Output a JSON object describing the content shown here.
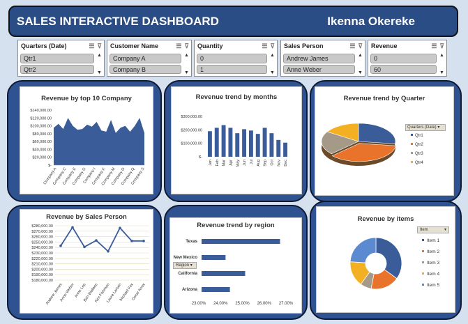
{
  "header": {
    "title": "SALES INTERACTIVE DASHBOARD",
    "author": "Ikenna Okereke"
  },
  "slicers": [
    {
      "title": "Quarters (Date)",
      "items": [
        "Qtr1",
        "Qtr2"
      ]
    },
    {
      "title": "Customer Name",
      "items": [
        "Company A",
        "Company B"
      ]
    },
    {
      "title": "Quantity",
      "items": [
        "0",
        "1"
      ]
    },
    {
      "title": "Sales Person",
      "items": [
        "Andrew James",
        "Anne Weber"
      ]
    },
    {
      "title": "Revenue",
      "items": [
        "0",
        "60"
      ]
    }
  ],
  "charts": {
    "company": {
      "title": "Revenue by top 10 Company"
    },
    "months": {
      "title": "Revenue trend by months"
    },
    "quarter": {
      "title": "Revenue trend by Quarter",
      "filter": "Quarters (Date)"
    },
    "person": {
      "title": "Revenue by Sales Person"
    },
    "region": {
      "title": "Revenue trend by region",
      "filter": "Region"
    },
    "items": {
      "title": "Revenue by items",
      "filter": "Item"
    }
  },
  "colors": {
    "dark": "#2f5290",
    "bar": "#3a5c99",
    "orange": "#e9732a",
    "gray": "#a59a88",
    "gold": "#f4b023"
  },
  "chart_data": [
    {
      "id": "company",
      "type": "area",
      "title": "Revenue by top 10 Company",
      "categories": [
        "Company A",
        "Company C",
        "Company E",
        "Company G",
        "Company I",
        "Company K",
        "Company M",
        "Company O",
        "Company Q",
        "Company S"
      ],
      "yticks": [
        "$-",
        "$20,000.00",
        "$40,000.00",
        "$60,000.00",
        "$80,000.00",
        "$100,000.00",
        "$120,000.00",
        "$140,000.00"
      ],
      "ylim": [
        0,
        140000
      ],
      "values": [
        95000,
        105000,
        92000,
        120000,
        100000,
        90000,
        92000,
        103000,
        98000,
        110000,
        88000,
        85000,
        115000,
        82000,
        95000,
        100000,
        85000,
        100000,
        120000,
        82000
      ]
    },
    {
      "id": "months",
      "type": "bar",
      "title": "Revenue trend by months",
      "categories": [
        "Jan",
        "Feb",
        "Mar",
        "Apr",
        "May",
        "Jun",
        "Jul",
        "Aug",
        "Sep",
        "Oct",
        "Nov",
        "Dec"
      ],
      "yticks": [
        "$-",
        "$100,000.00",
        "$200,000.00",
        "$300,000.00"
      ],
      "ylim": [
        0,
        300000
      ],
      "values": [
        190000,
        215000,
        235000,
        215000,
        175000,
        205000,
        195000,
        170000,
        215000,
        175000,
        125000,
        105000
      ]
    },
    {
      "id": "quarter",
      "type": "pie",
      "title": "Revenue trend by Quarter",
      "legend": [
        "Qtr1",
        "Qtr2",
        "Qtr3",
        "Qtr4"
      ],
      "values": [
        27,
        36,
        21,
        16
      ]
    },
    {
      "id": "person",
      "type": "line",
      "title": "Revenue by Sales Person",
      "categories": [
        "Andrew James",
        "Anne Weber",
        "Anne Lee",
        "Ben Wallace",
        "Kim Fishman",
        "Laura Larsen",
        "Michael Fox",
        "Oscar Knox"
      ],
      "yticks": [
        "$180,000.00",
        "$190,000.00",
        "$200,000.00",
        "$210,000.00",
        "$220,000.00",
        "$230,000.00",
        "$240,000.00",
        "$250,000.00",
        "$260,000.00",
        "$270,000.00",
        "$280,000.00"
      ],
      "ylim": [
        180000,
        280000
      ],
      "values": [
        243000,
        277000,
        241000,
        253000,
        233000,
        276000,
        252000,
        252000
      ]
    },
    {
      "id": "region",
      "type": "bar",
      "title": "Revenue trend by region",
      "categories": [
        "Texas",
        "New Mexico",
        "California",
        "Arizona"
      ],
      "xticks": [
        "23.00%",
        "24.00%",
        "25.00%",
        "26.00%",
        "27.00%"
      ],
      "xlim": [
        23,
        27
      ],
      "values": [
        26.6,
        24.1,
        25.0,
        24.3
      ]
    },
    {
      "id": "items",
      "type": "pie",
      "title": "Revenue by items",
      "legend": [
        "Item 1",
        "Item 2",
        "Item 3",
        "Item 4",
        "Item 5"
      ],
      "values": [
        35,
        18,
        7,
        16,
        24
      ]
    }
  ]
}
